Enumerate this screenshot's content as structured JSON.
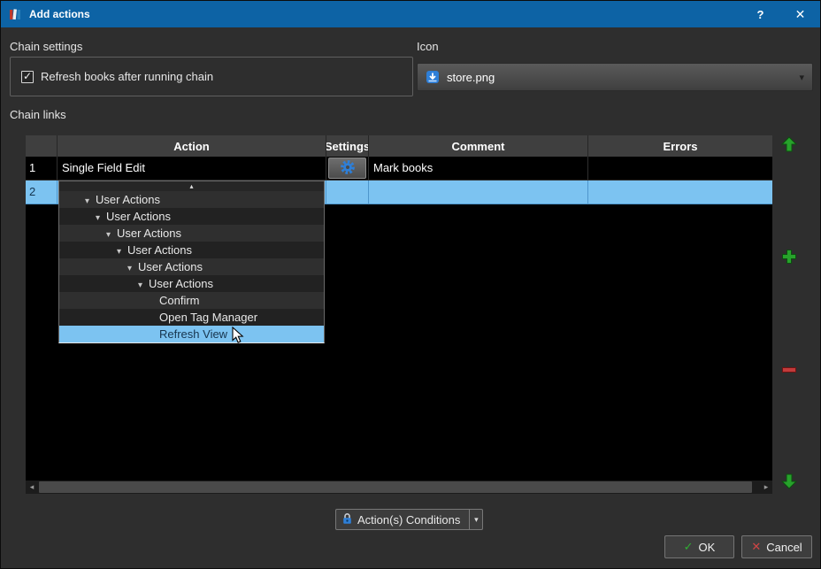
{
  "window": {
    "title": "Add actions",
    "help": "?",
    "close": "✕"
  },
  "chain_settings": {
    "label": "Chain settings",
    "refresh_checkbox": {
      "label": "Refresh books after running chain",
      "checked": true
    }
  },
  "icon_picker": {
    "label": "Icon",
    "value": "store.png"
  },
  "chain_links": {
    "label": "Chain links",
    "columns": [
      "Action",
      "Settings",
      "Comment",
      "Errors"
    ],
    "rows": [
      {
        "num": "1",
        "action": "Single Field Edit",
        "comment": "Mark books",
        "errors": ""
      },
      {
        "num": "2",
        "action": "",
        "comment": "",
        "errors": ""
      }
    ]
  },
  "action_dropdown": {
    "items": [
      {
        "label": "User Actions",
        "expandable": true
      },
      {
        "label": "User Actions",
        "expandable": true
      },
      {
        "label": "User Actions",
        "expandable": true
      },
      {
        "label": "User Actions",
        "expandable": true
      },
      {
        "label": "User Actions",
        "expandable": true
      },
      {
        "label": "User Actions",
        "expandable": true
      },
      {
        "label": "Confirm",
        "expandable": false
      },
      {
        "label": "Open Tag Manager",
        "expandable": false
      },
      {
        "label": "Refresh View",
        "expandable": false,
        "highlighted": true
      }
    ]
  },
  "conditions": {
    "label": "Action(s) Conditions"
  },
  "footer": {
    "ok": "OK",
    "cancel": "Cancel"
  },
  "glyphs": {
    "tree_expand": "▾",
    "scroll_up": "▴",
    "scroll_left": "◂",
    "scroll_right": "▸",
    "combo_arrow": "▾",
    "conditions_arrow": "▾",
    "check": "✓",
    "cross": "✕"
  },
  "colors": {
    "titlebar": "#0d63a5",
    "selection": "#7cc3f1",
    "green": "#27a22b",
    "red": "#c23b3b",
    "accent_blue": "#2e7fd8"
  }
}
